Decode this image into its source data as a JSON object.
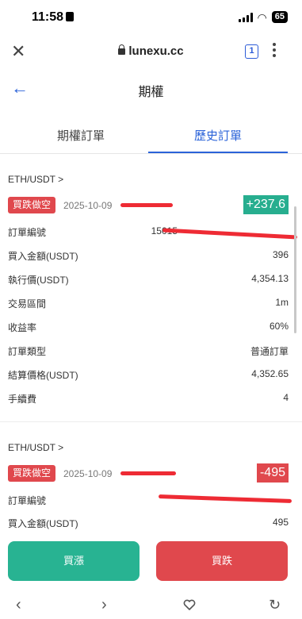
{
  "status_bar": {
    "time": "11:58",
    "battery": "65"
  },
  "browser": {
    "url": "lunexu.cc",
    "tab_count": "1"
  },
  "header": {
    "title": "期權"
  },
  "tabs": [
    {
      "label": "期權訂單",
      "active": false
    },
    {
      "label": "歷史訂單",
      "active": true
    }
  ],
  "orders": [
    {
      "pair": "ETH/USDT  >",
      "direction": "買跌做空",
      "date": "2025-10-09",
      "pnl": "+237.6",
      "fields": [
        {
          "label": "訂單編號",
          "value": "15015"
        },
        {
          "label": "買入金額(USDT)",
          "value": "396"
        },
        {
          "label": "執行價(USDT)",
          "value": "4,354.13"
        },
        {
          "label": "交易區間",
          "value": "1m"
        },
        {
          "label": "收益率",
          "value": "60%"
        },
        {
          "label": "訂單類型",
          "value": "普通訂單"
        },
        {
          "label": "結算價格(USDT)",
          "value": "4,352.65"
        },
        {
          "label": "手續費",
          "value": "4"
        }
      ]
    },
    {
      "pair": "ETH/USDT  >",
      "direction": "買跌做空",
      "date": "2025-10-09",
      "pnl": "-495",
      "fields": [
        {
          "label": "訂單編號",
          "value": ""
        },
        {
          "label": "買入金額(USDT)",
          "value": "495"
        }
      ]
    }
  ],
  "actions": {
    "buy_label": "買漲",
    "sell_label": "買跌"
  },
  "colors": {
    "accent": "#2b63d9",
    "up": "#28b392",
    "down": "#e0484d"
  }
}
